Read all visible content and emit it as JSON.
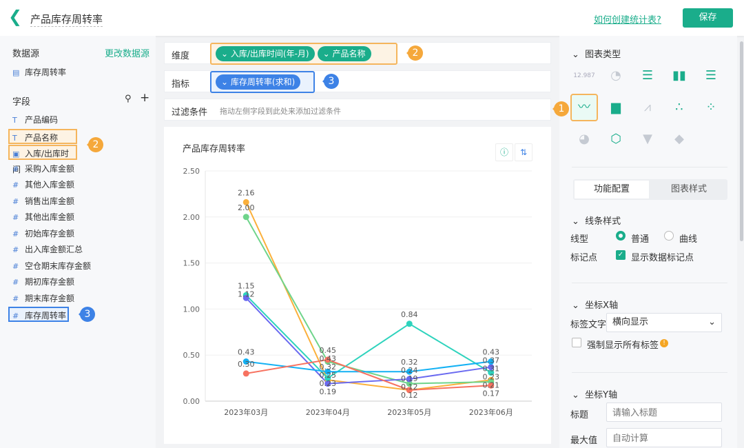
{
  "header": {
    "title": "产品库存周转率",
    "help_link": "如何创建统计表?",
    "save_label": "保存"
  },
  "left": {
    "datasource_label": "数据源",
    "change_link": "更改数据源",
    "datasource": "库存周转率",
    "fields_label": "字段",
    "fields": [
      {
        "type": "T",
        "name": "产品编码"
      },
      {
        "type": "T",
        "name": "产品名称"
      },
      {
        "type": "date",
        "name": "入库/出库时间"
      },
      {
        "type": "#",
        "name": "采购入库金额"
      },
      {
        "type": "#",
        "name": "其他入库金额"
      },
      {
        "type": "#",
        "name": "销售出库金额"
      },
      {
        "type": "#",
        "name": "其他出库金额"
      },
      {
        "type": "#",
        "name": "初始库存金额"
      },
      {
        "type": "#",
        "name": "出入库金额汇总"
      },
      {
        "type": "#",
        "name": "空仓期末库存金额"
      },
      {
        "type": "#",
        "name": "期初库存金额"
      },
      {
        "type": "#",
        "name": "期末库存金额"
      },
      {
        "type": "#",
        "name": "库存周转率"
      }
    ]
  },
  "config": {
    "dimension_label": "维度",
    "dimensions": [
      "入库/出库时间(年-月)",
      "产品名称"
    ],
    "metric_label": "指标",
    "metrics": [
      "库存周转率(求和)"
    ],
    "filter_label": "过滤条件",
    "filter_hint": "拖动左侧字段到此处来添加过滤条件"
  },
  "badges": [
    "1",
    "2",
    "3"
  ],
  "chart_data": {
    "type": "line",
    "title": "产品库存周转率",
    "categories": [
      "2023年03月",
      "2023年04月",
      "2023年05月",
      "2023年06月"
    ],
    "ylim": [
      0,
      2.5
    ],
    "yticks": [
      "0.00",
      "0.50",
      "1.00",
      "1.50",
      "2.00",
      "2.50"
    ],
    "grid": true,
    "data_labels": true,
    "series": [
      {
        "color": "#fbb03b",
        "values": [
          2.16,
          0.23,
          0.12,
          0.23
        ]
      },
      {
        "color": "#6fd48b",
        "values": [
          2.0,
          0.43,
          0.19,
          0.21
        ]
      },
      {
        "color": "#2ed3bd",
        "values": [
          1.15,
          0.25,
          0.84,
          0.31
        ]
      },
      {
        "color": "#6a6af0",
        "values": [
          1.12,
          0.19,
          0.24,
          0.37
        ]
      },
      {
        "color": "#13b1f4",
        "values": [
          0.43,
          0.32,
          0.32,
          0.43
        ]
      },
      {
        "color": "#f77260",
        "values": [
          0.3,
          0.45,
          0.12,
          0.17
        ]
      }
    ]
  },
  "right": {
    "chart_type_label": "图表类型",
    "chart_types": [
      "number",
      "gauge",
      "table",
      "column",
      "bar",
      "line",
      "area",
      "combo",
      "scatter",
      "bubble",
      "pie",
      "radar",
      "funnel",
      "map"
    ],
    "selected": "line",
    "tabs": [
      "功能配置",
      "图表样式"
    ],
    "line_style_label": "线条样式",
    "line_type_label": "线型",
    "line_types": [
      "普通",
      "曲线"
    ],
    "line_type_selected": "普通",
    "marker_label": "标记点",
    "marker_option": "显示数据标记点",
    "marker_checked": true,
    "xaxis_label": "坐标X轴",
    "tick_text_label": "标签文字",
    "tick_text_value": "横向显示",
    "force_all_label": "强制显示所有标签",
    "yaxis_label": "坐标Y轴",
    "ytitle_label": "标题",
    "ytitle_placeholder": "请输入标题",
    "ymax_label": "最大值",
    "ymax_placeholder": "自动计算"
  },
  "accent": "#1aad8b"
}
